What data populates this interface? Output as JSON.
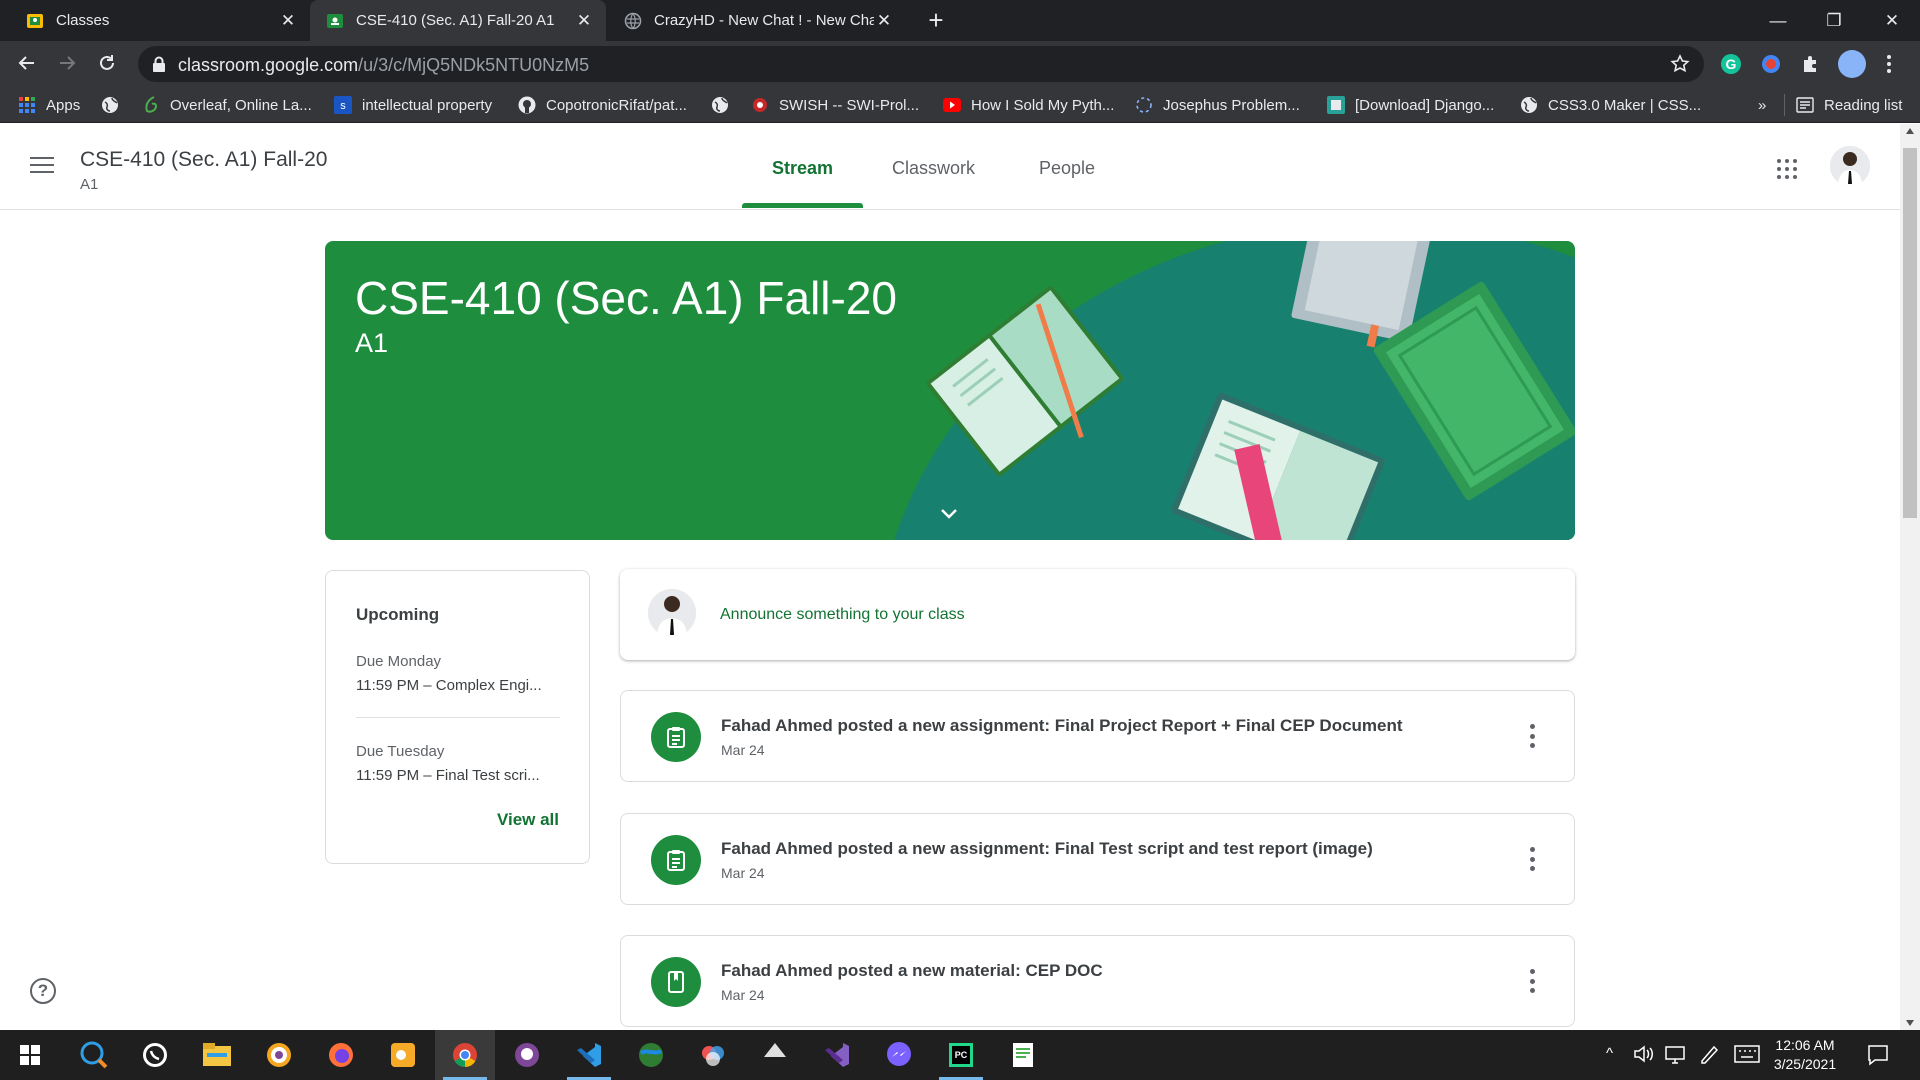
{
  "browser": {
    "tabs": [
      {
        "title": "Classes",
        "active": false
      },
      {
        "title": "CSE-410 (Sec. A1) Fall-20 A1",
        "active": true
      },
      {
        "title": "CrazyHD - New Chat ! - New Cha",
        "active": false
      }
    ],
    "new_tab_icon": "plus-icon",
    "url_host": "classroom.google.com",
    "url_path": "/u/3/c/MjQ5NDk5NTU0NzM5",
    "bookmarks": [
      {
        "label": "Apps",
        "icon": "apps-grid-icon"
      },
      {
        "label": "",
        "icon": "globe-icon"
      },
      {
        "label": "Overleaf, Online La...",
        "icon": "overleaf-icon"
      },
      {
        "label": "intellectual property",
        "icon": "scribd-icon"
      },
      {
        "label": "CopotronicRifat/pat...",
        "icon": "github-icon"
      },
      {
        "label": "",
        "icon": "globe-icon"
      },
      {
        "label": "SWISH -- SWI-Prol...",
        "icon": "swish-icon"
      },
      {
        "label": "How I Sold My Pyth...",
        "icon": "youtube-icon"
      },
      {
        "label": "Josephus Problem...",
        "icon": "loading-icon"
      },
      {
        "label": "[Download] Django...",
        "icon": "django-icon"
      },
      {
        "label": "CSS3.0 Maker | CSS...",
        "icon": "globe-icon"
      }
    ],
    "bookmarks_overflow": "»",
    "reading_list": "Reading list"
  },
  "classroom": {
    "class_name": "CSE-410 (Sec. A1) Fall-20",
    "section": "A1",
    "nav_tabs": [
      {
        "label": "Stream",
        "active": true
      },
      {
        "label": "Classwork",
        "active": false
      },
      {
        "label": "People",
        "active": false
      }
    ],
    "banner": {
      "title": "CSE-410 (Sec. A1) Fall-20",
      "subtitle": "A1",
      "colors": {
        "base": "#1e8e3e",
        "dark": "#17806e"
      }
    },
    "upcoming": {
      "title": "Upcoming",
      "items": [
        {
          "due": "Due Monday",
          "text": "11:59 PM – Complex Engi..."
        },
        {
          "due": "Due Tuesday",
          "text": "11:59 PM – Final Test scri..."
        }
      ],
      "view_all": "View all"
    },
    "announce_placeholder": "Announce something to your class",
    "posts": [
      {
        "title": "Fahad Ahmed posted a new assignment: Final Project Report + Final CEP Document",
        "date": "Mar 24",
        "icon": "assignment-icon"
      },
      {
        "title": "Fahad Ahmed posted a new assignment: Final Test script and test report (image)",
        "date": "Mar 24",
        "icon": "assignment-icon"
      },
      {
        "title": "Fahad Ahmed posted a new material: CEP DOC",
        "date": "Mar 24",
        "icon": "material-icon"
      }
    ],
    "accent_color": "#137333"
  },
  "taskbar": {
    "apps": [
      "windows-start-icon",
      "search-icon",
      "whatsapp-icon",
      "file-explorer-icon",
      "tor-icon",
      "firefox-icon",
      "paint-icon",
      "chrome-icon",
      "github-desktop-icon",
      "vscode-icon",
      "globe-app-icon",
      "colorful-icon",
      "inkscape-icon",
      "visual-studio-icon",
      "messenger-icon",
      "pycharm-icon",
      "notepad-icon"
    ],
    "time": "12:06 AM",
    "date": "3/25/2021"
  }
}
